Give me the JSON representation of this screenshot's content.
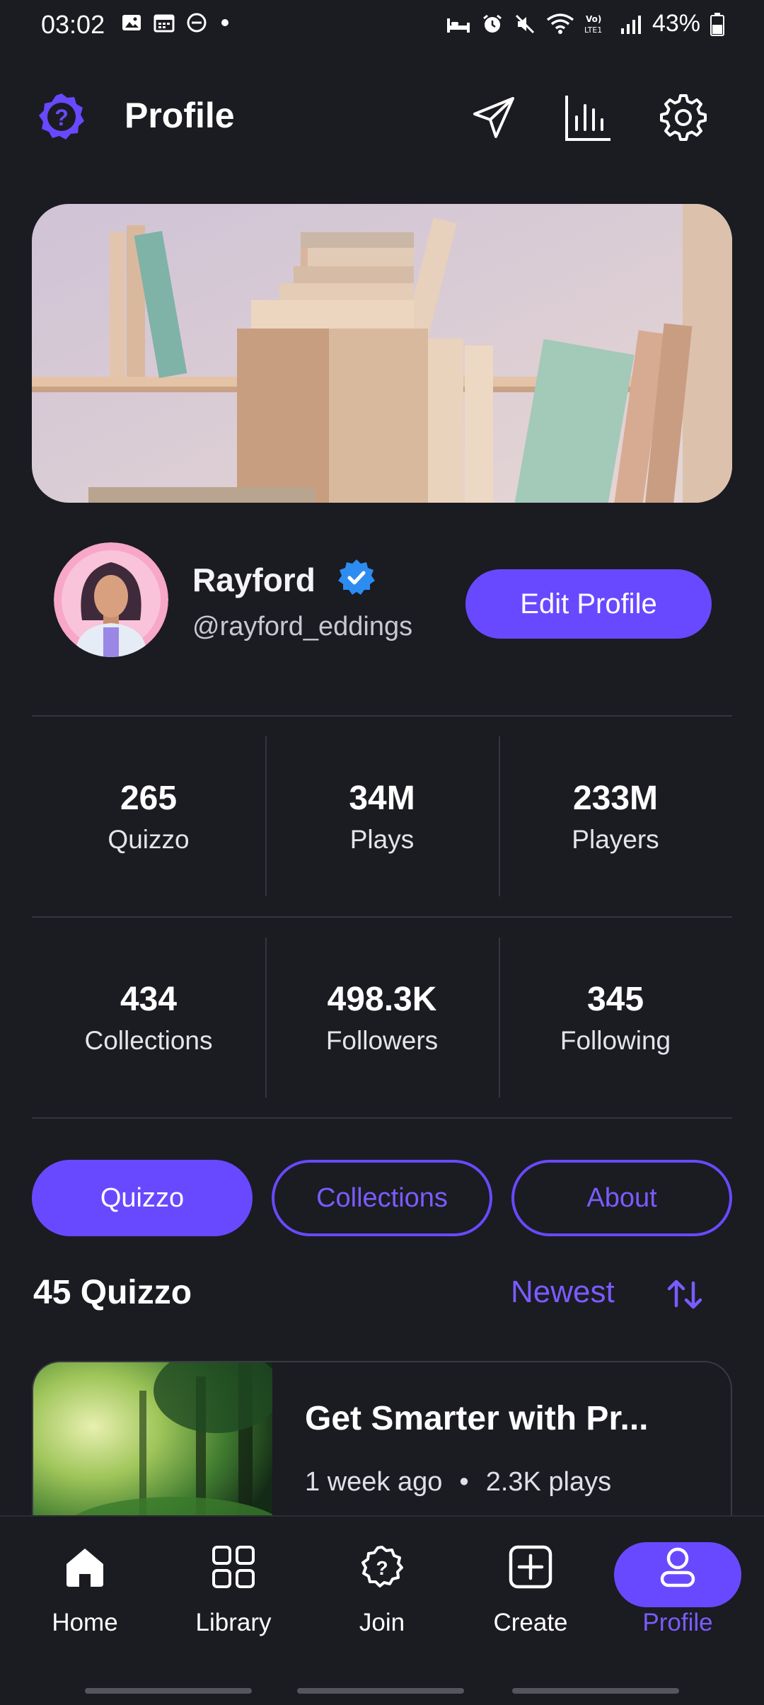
{
  "status_bar": {
    "time": "03:02",
    "battery": "43%"
  },
  "header": {
    "title": "Profile"
  },
  "user": {
    "name": "Rayford",
    "handle": "@rayford_eddings",
    "edit_label": "Edit Profile"
  },
  "stats": [
    {
      "value": "265",
      "label": "Quizzo"
    },
    {
      "value": "34M",
      "label": "Plays"
    },
    {
      "value": "233M",
      "label": "Players"
    },
    {
      "value": "434",
      "label": "Collections"
    },
    {
      "value": "498.3K",
      "label": "Followers"
    },
    {
      "value": "345",
      "label": "Following"
    }
  ],
  "tabs": [
    {
      "label": "Quizzo",
      "active": true
    },
    {
      "label": "Collections",
      "active": false
    },
    {
      "label": "About",
      "active": false
    }
  ],
  "list": {
    "title": "45 Quizzo",
    "sort": "Newest"
  },
  "quizzes": [
    {
      "title": "Get Smarter with Pr...",
      "age": "1 week ago",
      "plays": "2.3K plays"
    }
  ],
  "bottom_nav": [
    {
      "label": "Home",
      "icon": "home-icon"
    },
    {
      "label": "Library",
      "icon": "grid-icon"
    },
    {
      "label": "Join",
      "icon": "question-badge-icon"
    },
    {
      "label": "Create",
      "icon": "plus-square-icon"
    },
    {
      "label": "Profile",
      "icon": "user-icon",
      "active": true
    }
  ],
  "colors": {
    "accent": "#6949ff",
    "background": "#1b1b22",
    "divider": "#35353e"
  }
}
